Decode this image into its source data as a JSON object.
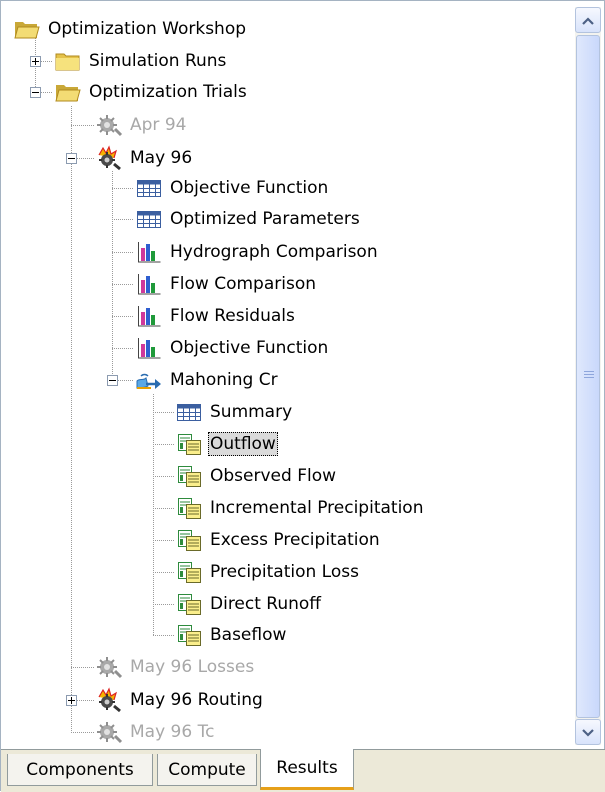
{
  "tree": {
    "root": "Optimization Workshop",
    "simulation_runs": "Simulation Runs",
    "optimization_trials": "Optimization Trials",
    "apr94": "Apr 94",
    "may96": "May 96",
    "may96_children": {
      "objective_function": "Objective Function",
      "optimized_parameters": "Optimized Parameters",
      "hydrograph_comparison": "Hydrograph Comparison",
      "flow_comparison": "Flow Comparison",
      "flow_residuals": "Flow Residuals",
      "objective_function_graph": "Objective Function",
      "mahoning_cr": "Mahoning Cr"
    },
    "mahoning_children": {
      "summary": "Summary",
      "outflow": "Outflow",
      "observed_flow": "Observed Flow",
      "incremental_precipitation": "Incremental Precipitation",
      "excess_precipitation": "Excess Precipitation",
      "precipitation_loss": "Precipitation Loss",
      "direct_runoff": "Direct Runoff",
      "baseflow": "Baseflow"
    },
    "may96_losses": "May 96 Losses",
    "may96_routing": "May 96 Routing",
    "may96_tc": "May 96 Tc"
  },
  "tabs": {
    "components": "Components",
    "compute": "Compute",
    "results": "Results"
  },
  "colors": {
    "selection_bg": "#dadada",
    "disabled_text": "#a8a8a8",
    "active_tab_accent": "#e6a019"
  }
}
